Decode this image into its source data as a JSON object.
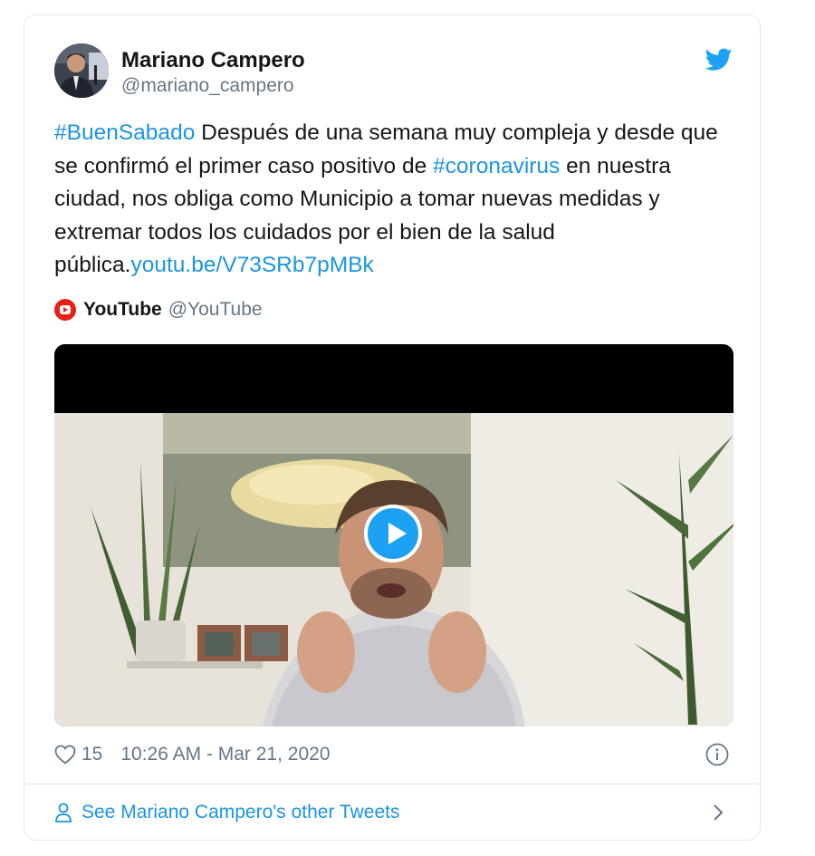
{
  "author": {
    "name": "Mariano Campero",
    "handle": "@mariano_campero",
    "avatar_icon": "profile-photo"
  },
  "tweet": {
    "hashtag1": "#BuenSabado",
    "text1": " Después de una semana muy compleja y desde que se confirmó el primer caso positivo de ",
    "hashtag2": "#coronavirus",
    "text2": " en nuestra ciudad, nos obliga como Municipio a tomar nuevas medidas y extremar todos los cuidados por el bien de la salud pública.",
    "link": "youtu.be/V73SRb7pMBk"
  },
  "card": {
    "source_name": "YouTube",
    "source_handle": "@YouTube",
    "play_icon": "play-icon"
  },
  "meta": {
    "likes": "15",
    "timestamp": "10:26 AM - Mar 21, 2020"
  },
  "footer": {
    "link_text": "See Mariano Campero's other Tweets"
  },
  "colors": {
    "link": "#1b95e0",
    "twitter_blue": "#1da1f2",
    "youtube_red": "#e62117",
    "secondary_text": "#657786"
  }
}
